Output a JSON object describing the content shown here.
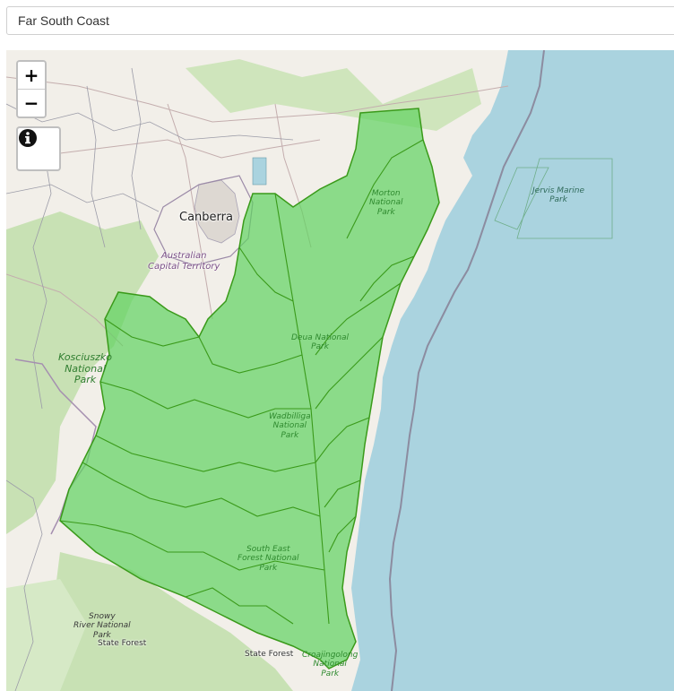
{
  "search": {
    "value": "Far South Coast"
  },
  "map": {
    "zoom_in_label": "+",
    "zoom_out_label": "−",
    "info_icon": "info-circle-icon",
    "region": "Far South Coast",
    "colors": {
      "ocean": "#aad3df",
      "land": "#f2efe9",
      "region_fill": "#5fd35f",
      "region_stroke": "#3a9a1a",
      "park_green": "#c8e1b4",
      "roads": "#c9b7b7",
      "boundary": "#8f8f9a",
      "state_border": "#9e88a8"
    },
    "labels": {
      "city": "Canberra",
      "territory": [
        "Australian",
        "Capital Territory"
      ],
      "kosciuszko": [
        "Kosciuszko",
        "National",
        "Park"
      ],
      "morton": [
        "Morton",
        "National",
        "Park"
      ],
      "jervis": [
        "Jervis Marine",
        "Park"
      ],
      "deua": [
        "Deua National",
        "Park"
      ],
      "wadbilliga": [
        "Wadbilliga",
        "National",
        "Park"
      ],
      "south_east_forest": [
        "South East",
        "Forest National",
        "Park"
      ],
      "snowy_river": [
        "Snowy",
        "River National",
        "Park"
      ],
      "state_forest_1": "State Forest",
      "state_forest_2": "State Forest",
      "croajingolong": [
        "Croajingolong",
        "National",
        "Park"
      ]
    }
  }
}
